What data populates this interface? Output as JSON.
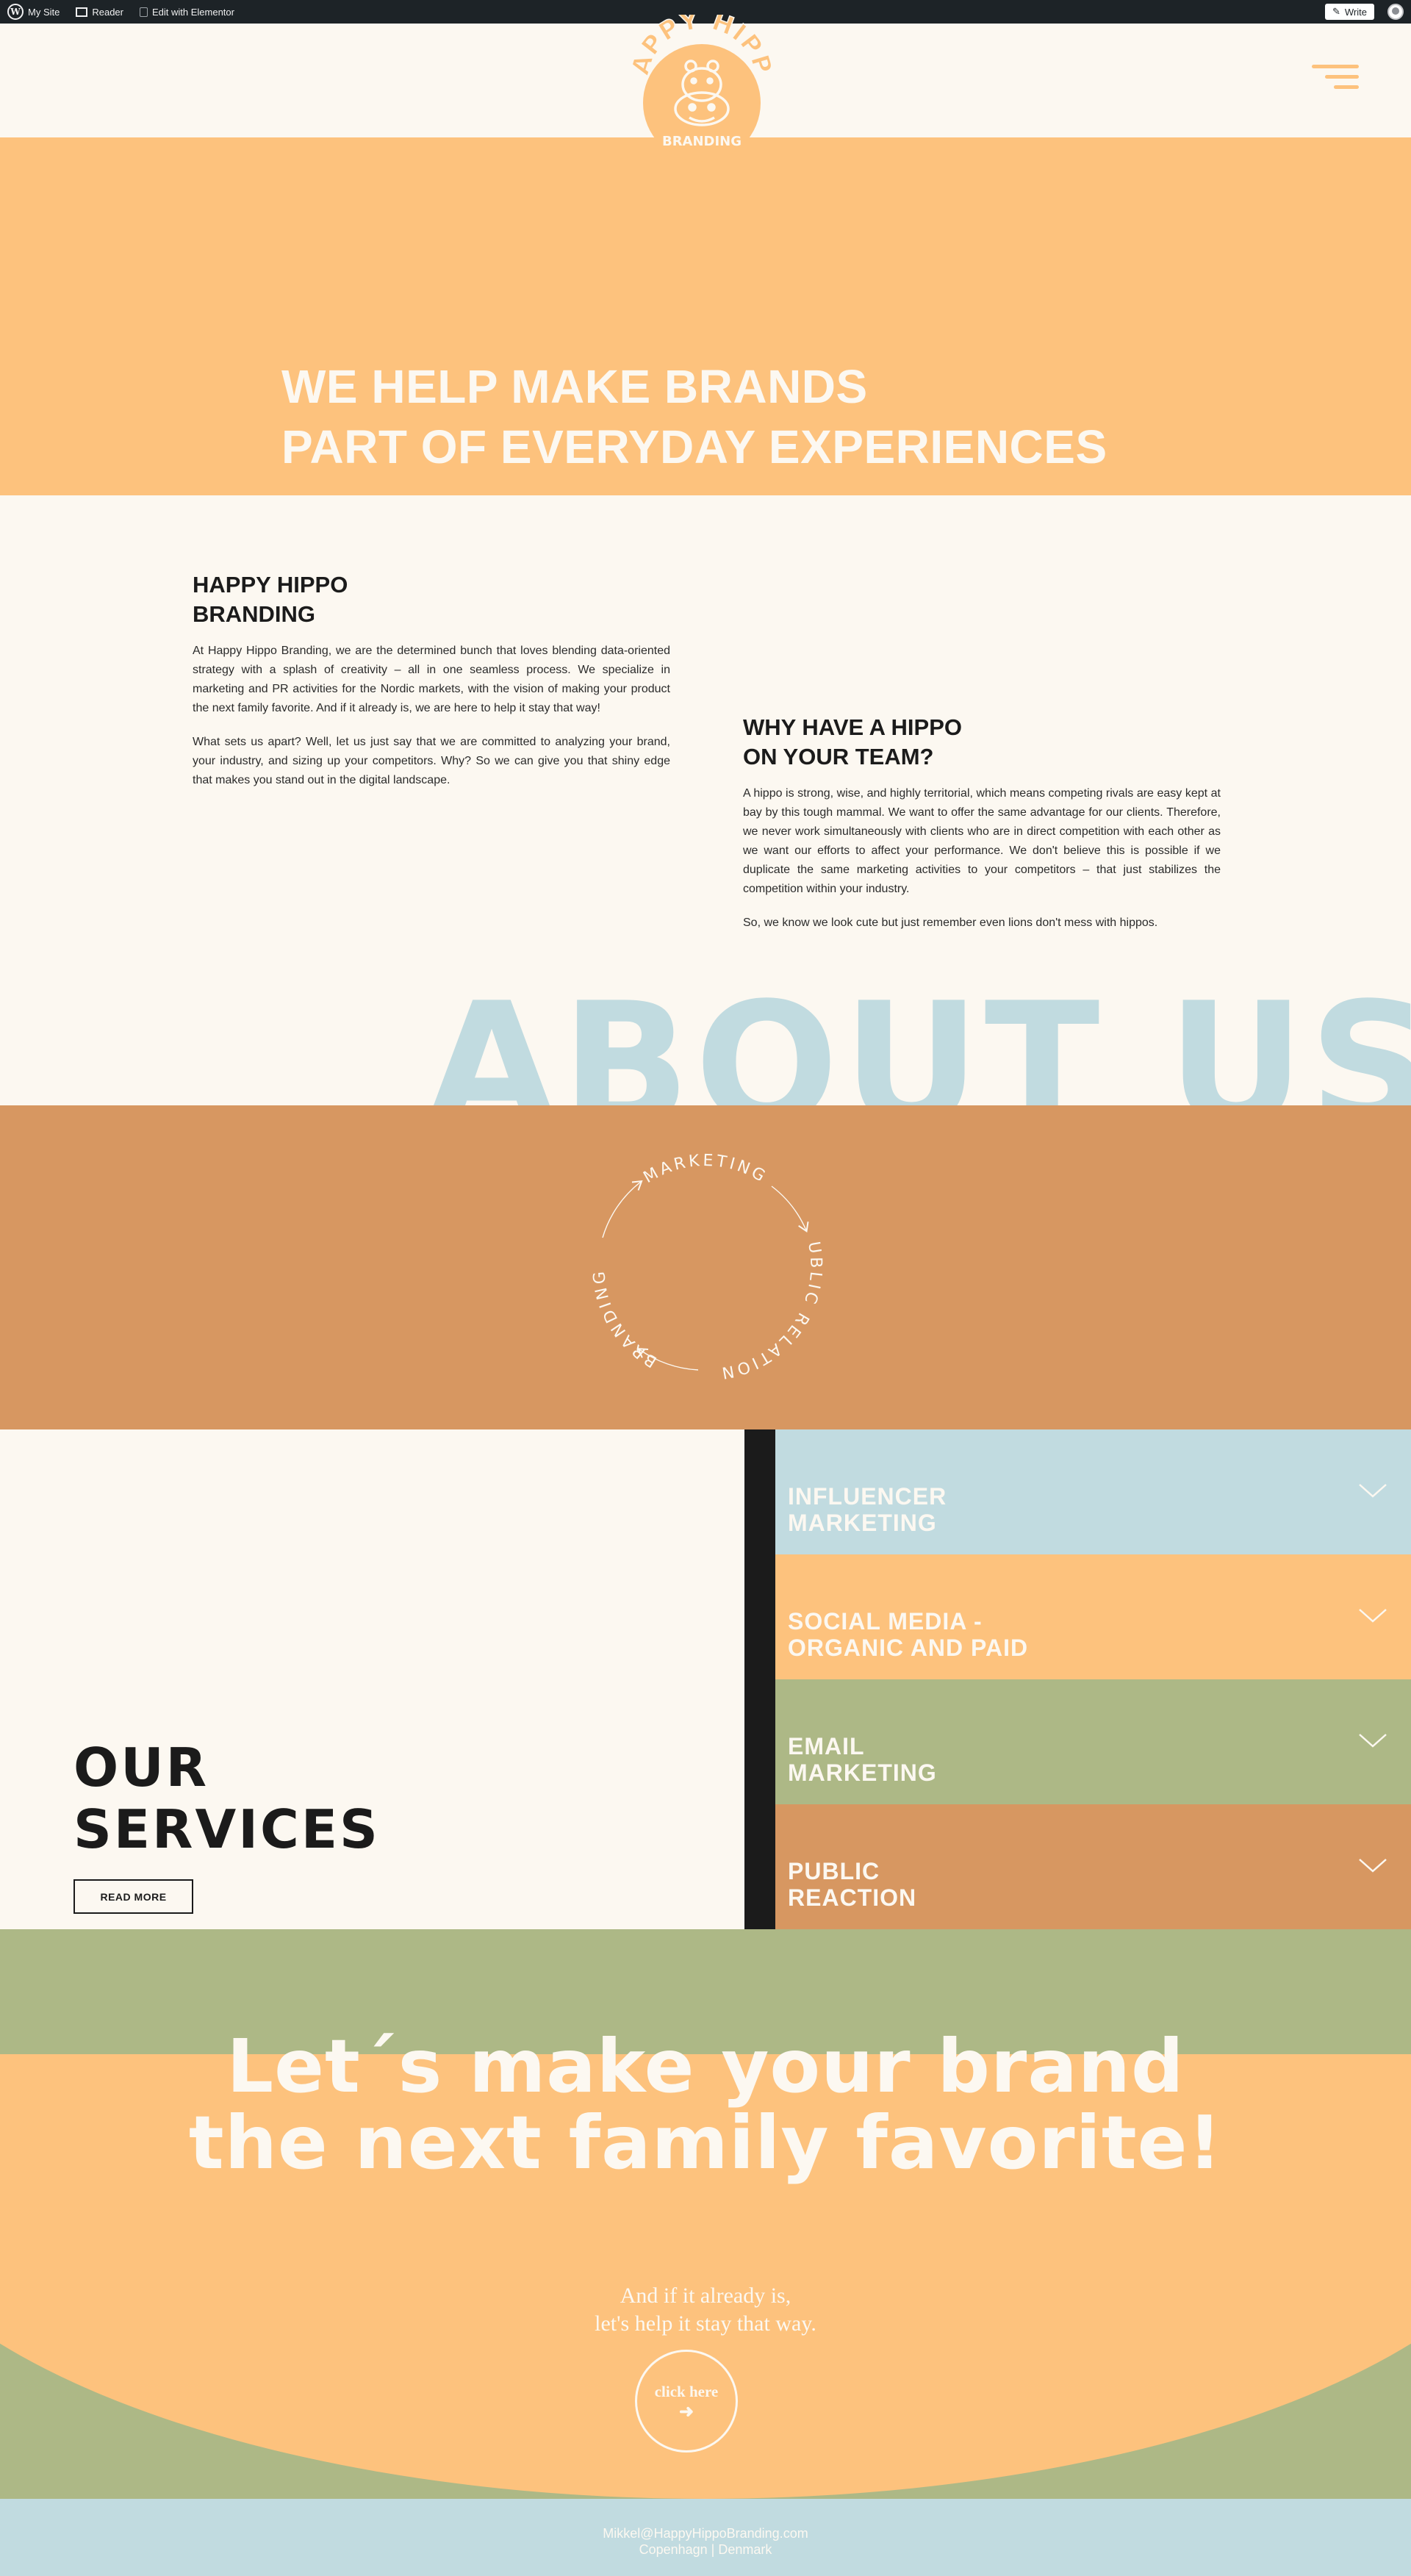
{
  "admin_bar": {
    "my_site": "My Site",
    "reader": "Reader",
    "edit_elementor": "Edit with Elementor",
    "write": "Write"
  },
  "logo": {
    "arc_text": "HAPPY HIPPO",
    "sub_text": "BRANDING"
  },
  "hero": {
    "line1": "WE HELP MAKE BRANDS",
    "line2": "PART OF EVERYDAY EXPERIENCES"
  },
  "intro": {
    "title_line1": "HAPPY HIPPO",
    "title_line2": "BRANDING",
    "p1": "At Happy Hippo Branding, we are the determined bunch that loves blending data-oriented strategy with a splash of creativity – all in one seamless process. We specialize in marketing and PR activities for the Nordic markets, with the vision of making your product the next family favorite. And if it already is, we are here to help it stay that way!",
    "p2": "What sets us apart? Well, let us just say that we are committed to analyzing your brand, your industry, and sizing up your competitors. Why? So we can give you that shiny edge that makes you stand out in the digital landscape."
  },
  "why": {
    "title_line1": "WHY HAVE A HIPPO",
    "title_line2": "ON YOUR TEAM?",
    "p1": "A hippo is strong, wise, and highly territorial, which means competing rivals are easy kept at bay by this tough mammal. We want to offer the same advantage for our clients. Therefore, we never work simultaneously with clients who are in direct competition with each other as we want our efforts to affect your performance. We don't believe this is possible if we duplicate the same marketing activities to your competitors – that just stabilizes the competition within your industry.",
    "p2": "So, we know we look cute but just remember even lions don't mess with hippos."
  },
  "about_big": "ABOUT US",
  "cycle": {
    "marketing": "MARKETING",
    "public_relations": "PUBLIC RELATIONS",
    "branding": "BRANDING"
  },
  "services": {
    "title_line1": "OUR",
    "title_line2": "SERVICES",
    "read_more": "READ MORE",
    "items": [
      {
        "line1": "INFLUENCER",
        "line2": "MARKETING",
        "color": "#c1dbe0"
      },
      {
        "line1": "SOCIAL MEDIA -",
        "line2": "ORGANIC AND PAID",
        "color": "#fdc27d"
      },
      {
        "line1": "EMAIL",
        "line2": "MARKETING",
        "color": "#adb886"
      },
      {
        "line1": "PUBLIC",
        "line2": "REACTION",
        "color": "#d79761"
      }
    ]
  },
  "cta": {
    "head_line1": "Let´s make your brand",
    "head_line2": "the next family favorite!",
    "sub_line1": "And if it already is,",
    "sub_line2": "let's help it stay that way.",
    "button": "click here"
  },
  "footer": {
    "email": "Mikkel@HappyHippoBranding.com",
    "location": "Copenhagn | Denmark"
  },
  "colors": {
    "cream": "#fcf8f1",
    "orange": "#fdc27d",
    "terracotta": "#d79761",
    "sky": "#c1dbe0",
    "olive": "#adb886",
    "ink": "#1b1b1b"
  }
}
